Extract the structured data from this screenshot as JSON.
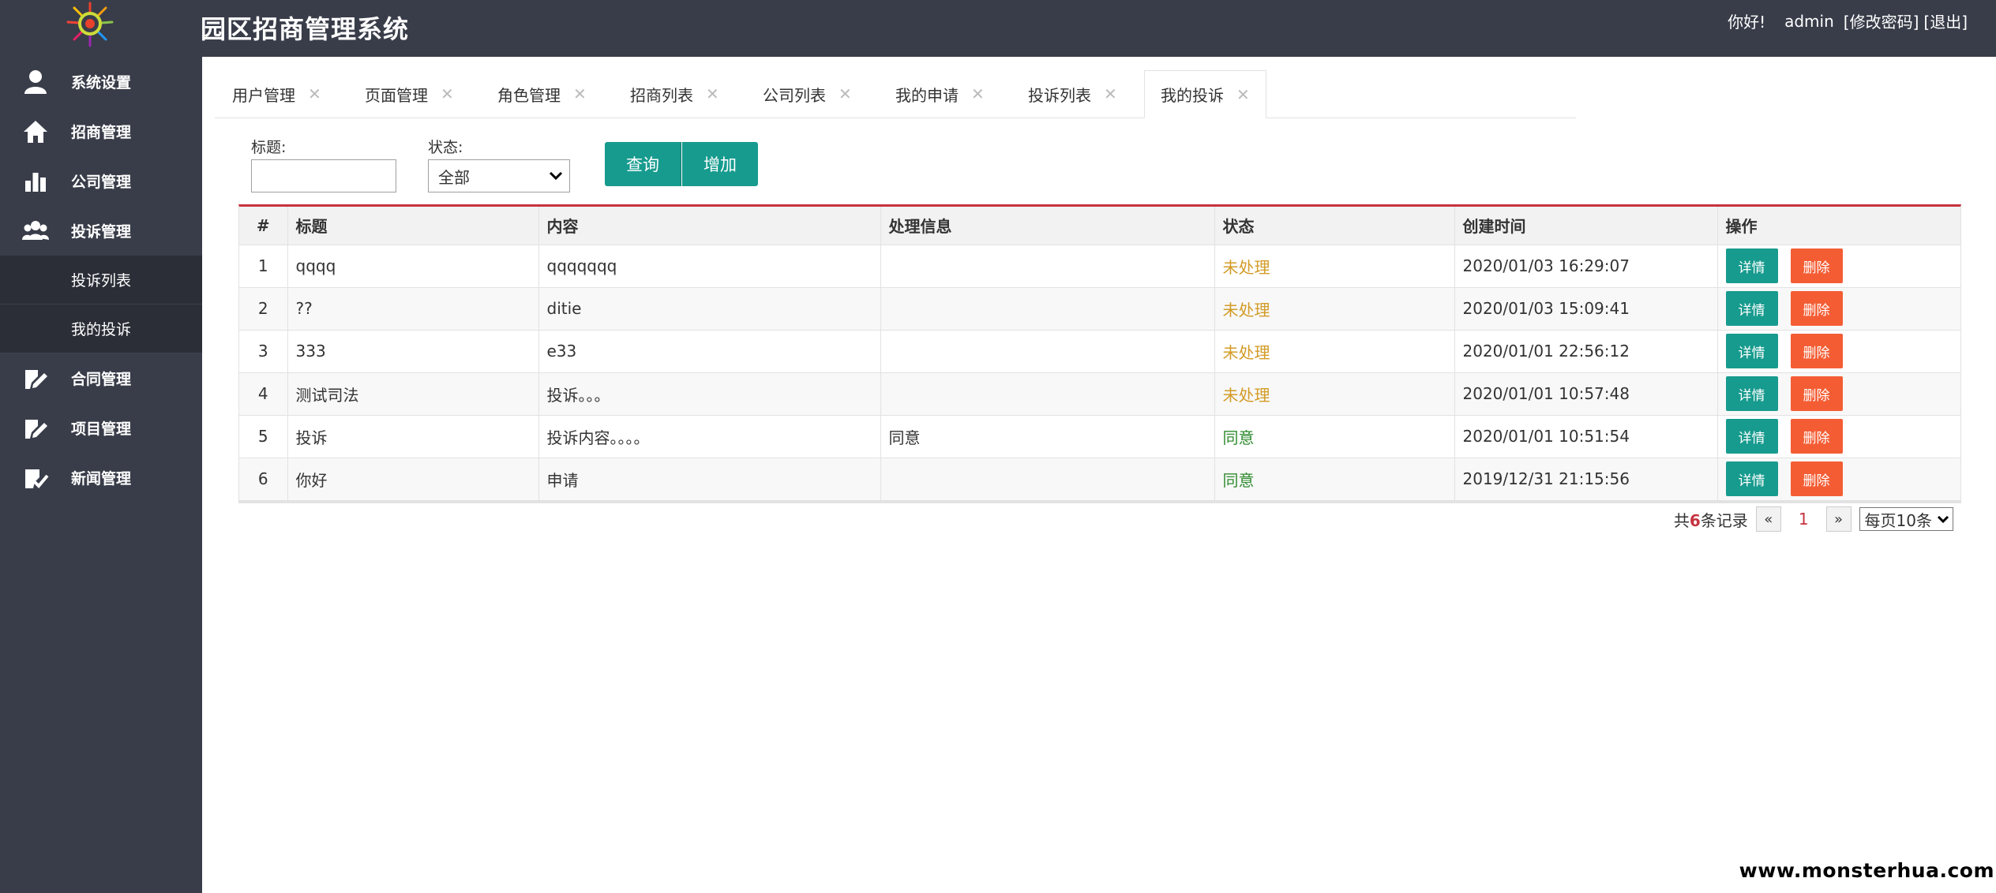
{
  "app": {
    "title": "园区招商管理系统"
  },
  "header": {
    "greeting": "你好!",
    "username": "admin",
    "change_password": "[修改密码]",
    "logout": "[退出]"
  },
  "sidebar": {
    "items": [
      {
        "label": "系统设置",
        "icon": "user-icon"
      },
      {
        "label": "招商管理",
        "icon": "home-icon"
      },
      {
        "label": "公司管理",
        "icon": "bar-chart-icon"
      },
      {
        "label": "投诉管理",
        "icon": "users-icon"
      }
    ],
    "subitems": [
      {
        "label": "投诉列表"
      },
      {
        "label": "我的投诉"
      }
    ],
    "items2": [
      {
        "label": "合同管理",
        "icon": "edit-doc-icon"
      },
      {
        "label": "项目管理",
        "icon": "edit-doc-icon"
      },
      {
        "label": "新闻管理",
        "icon": "check-doc-icon"
      }
    ]
  },
  "tabs": [
    {
      "label": "用户管理"
    },
    {
      "label": "页面管理"
    },
    {
      "label": "角色管理"
    },
    {
      "label": "招商列表"
    },
    {
      "label": "公司列表"
    },
    {
      "label": "我的申请"
    },
    {
      "label": "投诉列表"
    },
    {
      "label": "我的投诉",
      "active": true
    }
  ],
  "filters": {
    "title_label": "标题:",
    "title_value": "",
    "status_label": "状态:",
    "status_value": "全部",
    "query_label": "查询",
    "add_label": "增加"
  },
  "table": {
    "columns": [
      "#",
      "标题",
      "内容",
      "处理信息",
      "状态",
      "创建时间",
      "操作"
    ],
    "detail_label": "详情",
    "delete_label": "删除",
    "rows": [
      {
        "no": "1",
        "title": "qqqq",
        "content": "qqqqqqq",
        "handle": "",
        "status": "未处理",
        "status_type": "pending",
        "created": "2020/01/03 16:29:07"
      },
      {
        "no": "2",
        "title": "??",
        "content": "ditie",
        "handle": "",
        "status": "未处理",
        "status_type": "pending",
        "created": "2020/01/03 15:09:41"
      },
      {
        "no": "3",
        "title": "333",
        "content": "e33",
        "handle": "",
        "status": "未处理",
        "status_type": "pending",
        "created": "2020/01/01 22:56:12"
      },
      {
        "no": "4",
        "title": "测试司法",
        "content": "投诉。。。",
        "handle": "",
        "status": "未处理",
        "status_type": "pending",
        "created": "2020/01/01 10:57:48"
      },
      {
        "no": "5",
        "title": "投诉",
        "content": "投诉内容。。。。",
        "handle": "同意",
        "status": "同意",
        "status_type": "agree",
        "created": "2020/01/01 10:51:54"
      },
      {
        "no": "6",
        "title": "你好",
        "content": "申请",
        "handle": "",
        "status": "同意",
        "status_type": "agree",
        "created": "2019/12/31 21:15:56"
      }
    ]
  },
  "pagination": {
    "total_prefix": "共",
    "total_count": "6",
    "total_suffix": "条记录",
    "prev": "«",
    "current_page": "1",
    "next": "»",
    "page_size": "每页10条"
  },
  "colors": {
    "header_bg": "#393d49",
    "accent_teal": "#179b8e",
    "danger": "#f45d34",
    "pending": "#d39b26",
    "agree": "#2e8b2e",
    "table_top_border": "#c6333f"
  },
  "watermark": "www.monsterhua.com"
}
